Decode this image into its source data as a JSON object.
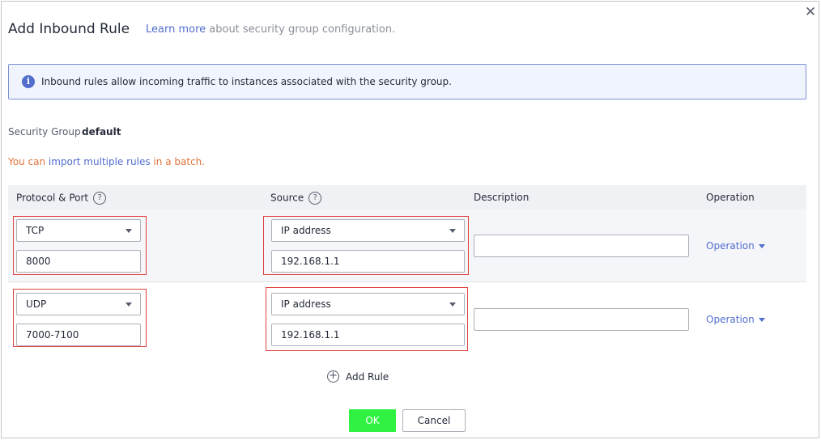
{
  "dialog": {
    "title": "Add Inbound Rule",
    "learn_more": "Learn more",
    "learn_more_suffix": " about security group configuration.",
    "close_icon": "close-icon"
  },
  "banner": {
    "icon": "info-icon",
    "text": "Inbound rules allow incoming traffic to instances associated with the security group."
  },
  "security_group": {
    "label": "Security Group",
    "value": "default"
  },
  "batch": {
    "prefix": "You can ",
    "link": "import multiple rules",
    "suffix": " in a batch."
  },
  "table": {
    "headers": {
      "protocol_port": "Protocol & Port",
      "source": "Source",
      "description": "Description",
      "operation": "Operation"
    },
    "rows": [
      {
        "protocol": "TCP",
        "port": "8000",
        "source_type": "IP address",
        "source_value": "192.168.1.1",
        "description": "",
        "operation": "Operation"
      },
      {
        "protocol": "UDP",
        "port": "7000-7100",
        "source_type": "IP address",
        "source_value": "192.168.1.1",
        "description": "",
        "operation": "Operation"
      }
    ]
  },
  "add_rule": "Add Rule",
  "buttons": {
    "ok": "OK",
    "cancel": "Cancel"
  },
  "colors": {
    "ok_button": "#2ff243",
    "link": "#526ecc",
    "highlight_border": "#e0403b",
    "batch_text": "#e0743b"
  }
}
